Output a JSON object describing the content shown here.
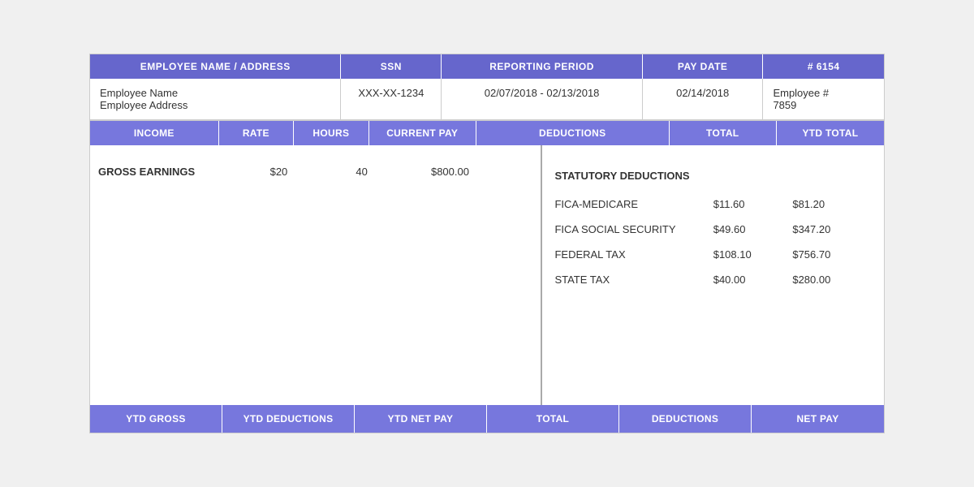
{
  "header": {
    "col1": "EMPLOYEE NAME / ADDRESS",
    "col2": "SSN",
    "col3": "REPORTING PERIOD",
    "col4": "PAY DATE",
    "col5": "# 6154"
  },
  "info": {
    "employee_name": "Employee Name",
    "employee_address": "Employee Address",
    "ssn": "XXX-XX-1234",
    "reporting_period": "02/07/2018 - 02/13/2018",
    "pay_date": "02/14/2018",
    "check_label": "Employee #",
    "employee_number": "7859"
  },
  "col_headers": {
    "income": "INCOME",
    "rate": "RATE",
    "hours": "HOURS",
    "current_pay": "CURRENT PAY",
    "deductions": "DEDUCTIONS",
    "total": "TOTAL",
    "ytd_total": "YTD TOTAL"
  },
  "income": {
    "label": "GROSS EARNINGS",
    "rate": "$20",
    "hours": "40",
    "current_pay": "$800.00"
  },
  "deductions": {
    "statutory_label": "STATUTORY DEDUCTIONS",
    "items": [
      {
        "name": "FICA-MEDICARE",
        "total": "$11.60",
        "ytd": "$81.20"
      },
      {
        "name": "FICA SOCIAL SECURITY",
        "total": "$49.60",
        "ytd": "$347.20"
      },
      {
        "name": "FEDERAL TAX",
        "total": "$108.10",
        "ytd": "$756.70"
      },
      {
        "name": "STATE TAX",
        "total": "$40.00",
        "ytd": "$280.00"
      }
    ]
  },
  "footer": {
    "ytd_gross": "YTD GROSS",
    "ytd_deductions": "YTD DEDUCTIONS",
    "ytd_net_pay": "YTD NET PAY",
    "total": "TOTAL",
    "deductions": "DEDUCTIONS",
    "net_pay": "NET PAY"
  },
  "colors": {
    "header_bg": "#7777cc",
    "header_text": "#ffffff",
    "border": "#cccccc"
  }
}
